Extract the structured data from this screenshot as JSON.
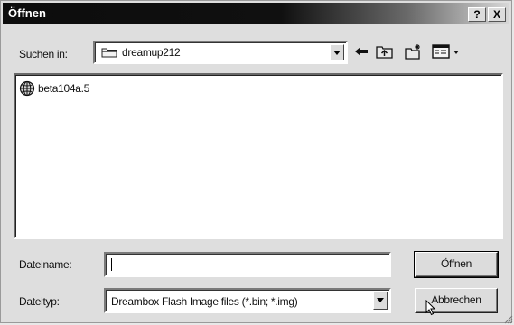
{
  "dialog": {
    "title": "Öffnen",
    "help_label": "?",
    "close_label": "X"
  },
  "look_in": {
    "label": "Suchen in:",
    "value": "dreamup212",
    "icon": "folder-icon"
  },
  "toolbar": {
    "icons": [
      "back-arrow-icon",
      "up-folder-icon",
      "new-folder-icon",
      "view-menu-icon"
    ]
  },
  "file_list": {
    "items": [
      {
        "name": "beta104a.5",
        "icon": "globe-file-icon"
      }
    ]
  },
  "file_name": {
    "label": "Dateiname:",
    "value": ""
  },
  "file_type": {
    "label": "Dateityp:",
    "value": "Dreambox Flash Image files (*.bin; *.img)"
  },
  "buttons": {
    "open_label": "Öffnen",
    "cancel_label": "Abbrechen"
  }
}
